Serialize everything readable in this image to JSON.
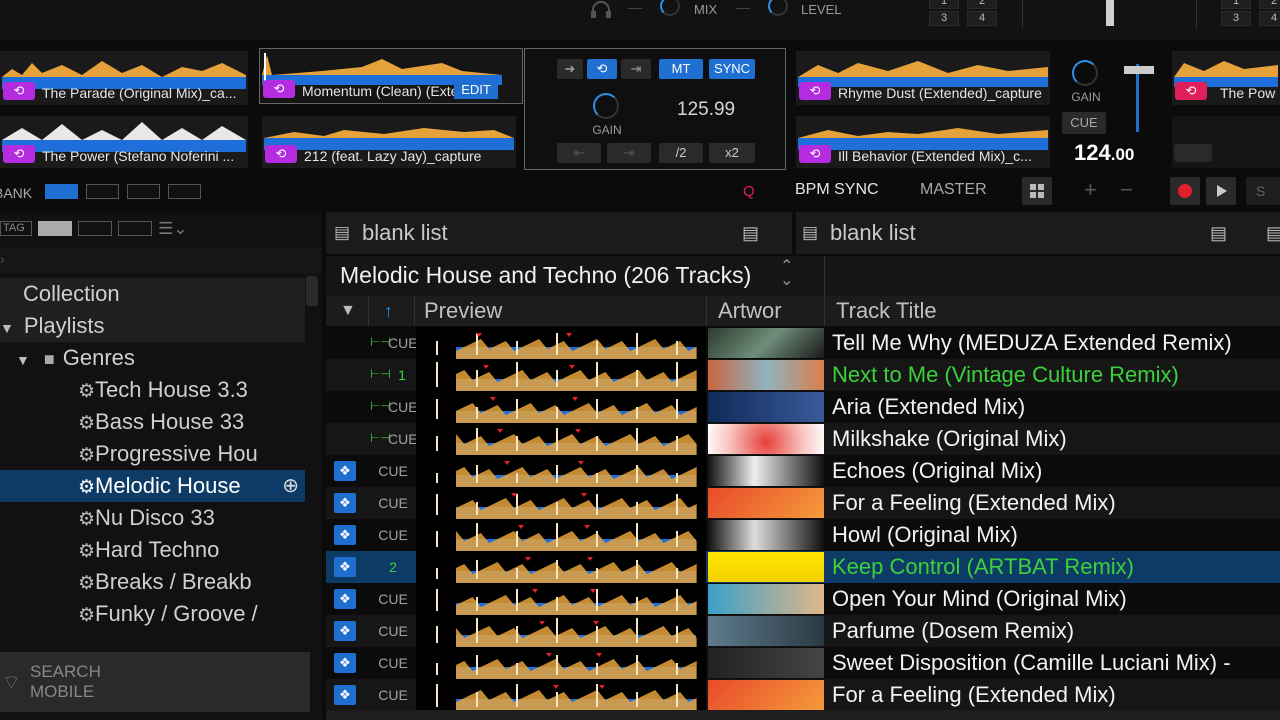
{
  "mixer": {
    "mix_label": "MIX",
    "level_label": "LEVEL",
    "hotcue_numbers_left": [
      "1",
      "2",
      "3",
      "4"
    ],
    "hotcue_numbers_right": [
      "1",
      "2",
      "3",
      "4"
    ]
  },
  "samplers_left": [
    {
      "name": "The Parade (Original Mix)_ca..."
    },
    {
      "name": "Momentum (Clean) (Exte"
    },
    {
      "name": "The Power (Stefano Noferini ..."
    },
    {
      "name": "212 (feat. Lazy Jay)_capture"
    }
  ],
  "edit_label": "EDIT",
  "center_ctrl": {
    "mt": "MT",
    "sync": "SYNC",
    "gain": "GAIN",
    "bpm": "125.99",
    "half": "/2",
    "double": "x2"
  },
  "samplers_right": [
    {
      "name": "Rhyme Dust (Extended)_capture"
    },
    {
      "name": "Ill Behavior (Extended Mix)_c..."
    },
    {
      "name": "The Powe"
    }
  ],
  "right_ctrl": {
    "gain": "GAIN",
    "cue": "CUE",
    "bpm_main": "124",
    "bpm_dec": ".00"
  },
  "bank_label": "BANK",
  "transport": {
    "q": "Q",
    "bpm_sync": "BPM SYNC",
    "master": "MASTER",
    "plus": "+",
    "minus": "−",
    "s_label": "S"
  },
  "sidebar": {
    "tag_label": "TAG",
    "items": [
      {
        "label": "Collection"
      },
      {
        "label": "Playlists"
      },
      {
        "label": "Genres"
      },
      {
        "label": "Tech House 3.3"
      },
      {
        "label": "Bass House 33"
      },
      {
        "label": "Progressive Hou"
      },
      {
        "label": "Melodic House"
      },
      {
        "label": "Nu Disco 33"
      },
      {
        "label": "Hard Techno"
      },
      {
        "label": "Breaks / Breakb"
      },
      {
        "label": "Funky / Groove /"
      }
    ],
    "search_mobile_line1": "SEARCH",
    "search_mobile_line2": "MOBILE"
  },
  "lists": {
    "left_title": "blank list",
    "right_title": "blank list"
  },
  "playlist": {
    "title": "Melodic House and Techno (206 Tracks)"
  },
  "columns": {
    "preview": "Preview",
    "artwork": "Artwor",
    "track_title": "Track Title"
  },
  "tracks": [
    {
      "cue": "CUE",
      "title": "Tell Me Why (MEDUZA Extended Remix)",
      "color": "#f2f2f2"
    },
    {
      "cue": "1",
      "title": "Next to Me (Vintage Culture Remix)",
      "color": "#3ad13a"
    },
    {
      "cue": "CUE",
      "title": "Aria (Extended Mix)",
      "color": "#f2f2f2"
    },
    {
      "cue": "CUE",
      "title": "Milkshake (Original Mix)",
      "color": "#f2f2f2"
    },
    {
      "cue": "CUE",
      "title": "Echoes (Original Mix)",
      "color": "#f2f2f2"
    },
    {
      "cue": "CUE",
      "title": "For a Feeling (Extended Mix)",
      "color": "#f2f2f2"
    },
    {
      "cue": "CUE",
      "title": "Howl (Original Mix)",
      "color": "#f2f2f2"
    },
    {
      "cue": "2",
      "title": "Keep Control (ARTBAT Remix)",
      "color": "#3ad13a"
    },
    {
      "cue": "CUE",
      "title": "Open Your Mind (Original Mix)",
      "color": "#f2f2f2"
    },
    {
      "cue": "CUE",
      "title": "Parfume (Dosem Remix)",
      "color": "#f2f2f2"
    },
    {
      "cue": "CUE",
      "title": "Sweet Disposition (Camille Luciani Mix) -",
      "color": "#f2f2f2"
    },
    {
      "cue": "CUE",
      "title": "For a Feeling (Extended Mix)",
      "color": "#f2f2f2"
    }
  ],
  "colors": {
    "accent": "#1f6fd1",
    "loop_purple": "#b52be0",
    "loop_red": "#e0205a",
    "selected_row": "#0e3a66",
    "green_text": "#3ad13a"
  }
}
